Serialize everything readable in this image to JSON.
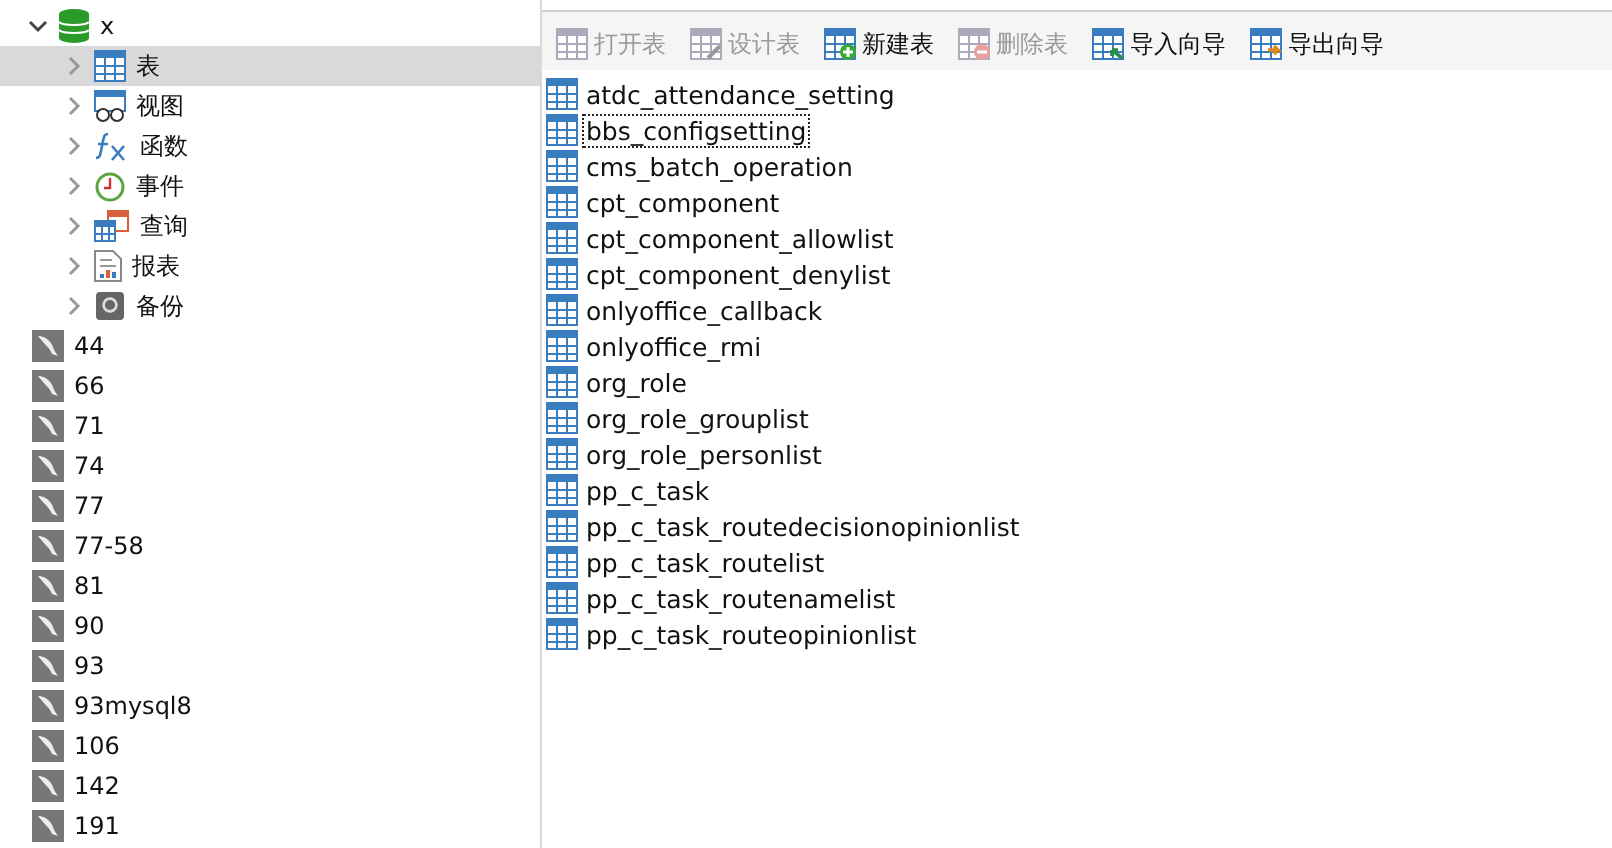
{
  "tree": {
    "database": {
      "label": "x",
      "expanded": true,
      "children": [
        {
          "label": "表",
          "kind": "table",
          "selected": true
        },
        {
          "label": "视图",
          "kind": "view",
          "selected": false
        },
        {
          "label": "函数",
          "kind": "function",
          "selected": false
        },
        {
          "label": "事件",
          "kind": "event",
          "selected": false
        },
        {
          "label": "查询",
          "kind": "query",
          "selected": false
        },
        {
          "label": "报表",
          "kind": "report",
          "selected": false
        },
        {
          "label": "备份",
          "kind": "backup",
          "selected": false
        }
      ]
    },
    "connections": [
      {
        "label": "44"
      },
      {
        "label": "66"
      },
      {
        "label": "71"
      },
      {
        "label": "74"
      },
      {
        "label": "77"
      },
      {
        "label": "77-58"
      },
      {
        "label": "81"
      },
      {
        "label": "90"
      },
      {
        "label": "93"
      },
      {
        "label": "93mysql8"
      },
      {
        "label": "106"
      },
      {
        "label": "142"
      },
      {
        "label": "191"
      }
    ]
  },
  "toolbar": [
    {
      "label": "打开表",
      "kind": "open",
      "disabled": true
    },
    {
      "label": "设计表",
      "kind": "design",
      "disabled": true
    },
    {
      "label": "新建表",
      "kind": "new",
      "disabled": false
    },
    {
      "label": "删除表",
      "kind": "delete",
      "disabled": true
    },
    {
      "label": "导入向导",
      "kind": "import",
      "disabled": false
    },
    {
      "label": "导出向导",
      "kind": "export",
      "disabled": false
    }
  ],
  "tables": [
    {
      "name": "atdc_attendance_setting",
      "focused": false
    },
    {
      "name": "bbs_configsetting",
      "focused": true
    },
    {
      "name": "cms_batch_operation",
      "focused": false
    },
    {
      "name": "cpt_component",
      "focused": false
    },
    {
      "name": "cpt_component_allowlist",
      "focused": false
    },
    {
      "name": "cpt_component_denylist",
      "focused": false
    },
    {
      "name": "onlyoffice_callback",
      "focused": false
    },
    {
      "name": "onlyoffice_rmi",
      "focused": false
    },
    {
      "name": "org_role",
      "focused": false
    },
    {
      "name": "org_role_grouplist",
      "focused": false
    },
    {
      "name": "org_role_personlist",
      "focused": false
    },
    {
      "name": "pp_c_task",
      "focused": false
    },
    {
      "name": "pp_c_task_routedecisionopinionlist",
      "focused": false
    },
    {
      "name": "pp_c_task_routelist",
      "focused": false
    },
    {
      "name": "pp_c_task_routenamelist",
      "focused": false
    },
    {
      "name": "pp_c_task_routeopinionlist",
      "focused": false
    }
  ]
}
